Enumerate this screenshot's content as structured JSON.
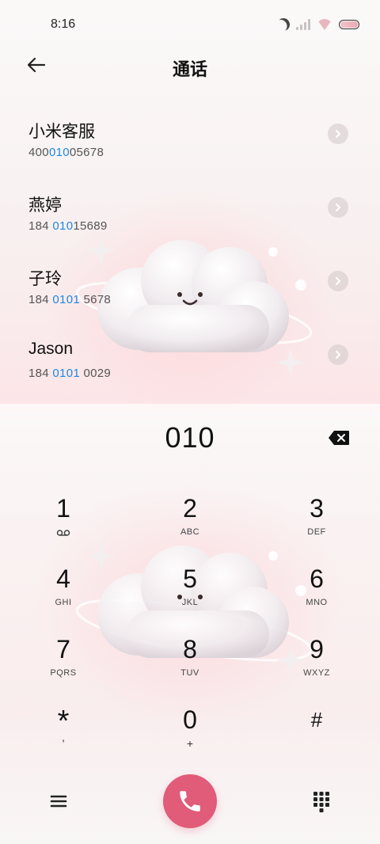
{
  "status_bar": {
    "time": "8:16"
  },
  "header": {
    "title": "通话"
  },
  "contacts": [
    {
      "name": "小米客服",
      "number_pre": "400",
      "number_hl": "010",
      "number_post": "05678"
    },
    {
      "name": "燕婷",
      "number_pre": "184 ",
      "number_hl": "010",
      "number_post": "15689"
    },
    {
      "name": "子玲",
      "number_pre": "184 ",
      "number_hl": "0101",
      "number_post": " 5678"
    },
    {
      "name": "Jason",
      "number_pre": "184 ",
      "number_hl": "0101",
      "number_post": " 0029"
    }
  ],
  "dialer": {
    "input": "010"
  },
  "keypad": [
    {
      "digit": "1",
      "letters": ""
    },
    {
      "digit": "2",
      "letters": "ABC"
    },
    {
      "digit": "3",
      "letters": "DEF"
    },
    {
      "digit": "4",
      "letters": "GHI"
    },
    {
      "digit": "5",
      "letters": "JKL"
    },
    {
      "digit": "6",
      "letters": "MNO"
    },
    {
      "digit": "7",
      "letters": "PQRS"
    },
    {
      "digit": "8",
      "letters": "TUV"
    },
    {
      "digit": "9",
      "letters": "WXYZ"
    },
    {
      "digit": "*",
      "letters": ","
    },
    {
      "digit": "0",
      "letters": "+"
    },
    {
      "digit": "#",
      "letters": ""
    }
  ],
  "colors": {
    "accent": "#e05c79",
    "highlight": "#1e88e5"
  },
  "icons": {
    "back": "arrow-left-icon",
    "chevron": "chevron-right-icon",
    "backspace": "backspace-icon",
    "voicemail": "voicemail-icon",
    "menu": "menu-icon",
    "call": "phone-icon",
    "keypad": "dialpad-icon"
  }
}
